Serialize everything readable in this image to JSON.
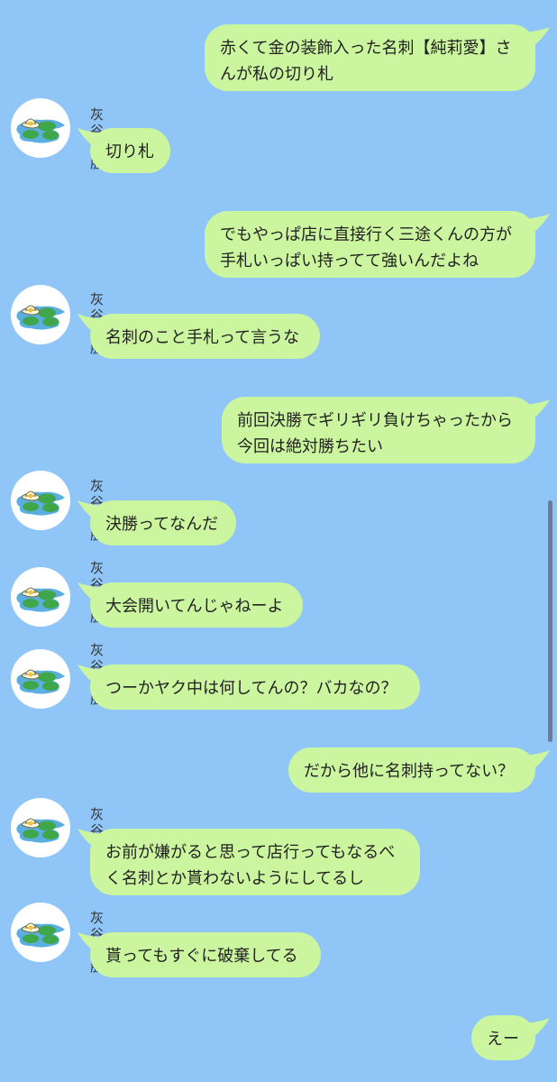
{
  "contact_name": "灰谷竜胆",
  "avatar_icon": "water-lily-icon",
  "colors": {
    "background": "#8fc6f7",
    "bubble": "#ccf5a0",
    "text": "#222222"
  },
  "messages": [
    {
      "sender": "me",
      "lines": [
        "赤くて金の装飾入った名刺【純莉愛】さ",
        "んが私の切り札"
      ]
    },
    {
      "sender": "other",
      "name": "灰谷竜胆",
      "lines": [
        "切り札"
      ]
    },
    {
      "sender": "me",
      "lines": [
        "でもやっぱ店に直接行く三途くんの方が",
        "手札いっぱい持ってて強いんだよね"
      ]
    },
    {
      "sender": "other",
      "name": "灰谷竜胆",
      "lines": [
        "名刺のこと手札って言うな"
      ]
    },
    {
      "sender": "me",
      "lines": [
        "前回決勝でギリギリ負けちゃったから",
        "今回は絶対勝ちたい"
      ]
    },
    {
      "sender": "other",
      "name": "灰谷竜胆",
      "lines": [
        "決勝ってなんだ"
      ]
    },
    {
      "sender": "other",
      "name": "灰谷竜胆",
      "lines": [
        "大会開いてんじゃねーよ"
      ]
    },
    {
      "sender": "other",
      "name": "灰谷竜胆",
      "lines": [
        "つーかヤク中は何してんの？バカなの？"
      ]
    },
    {
      "sender": "me",
      "lines": [
        "だから他に名刺持ってない？"
      ]
    },
    {
      "sender": "other",
      "name": "灰谷竜胆",
      "lines": [
        "お前が嫌がると思って店行ってもなるべ",
        "く名刺とか貰わないようにしてるし"
      ]
    },
    {
      "sender": "other",
      "name": "灰谷竜胆",
      "lines": [
        "貰ってもすぐに破棄してる"
      ]
    },
    {
      "sender": "me",
      "lines": [
        "えー"
      ]
    }
  ]
}
